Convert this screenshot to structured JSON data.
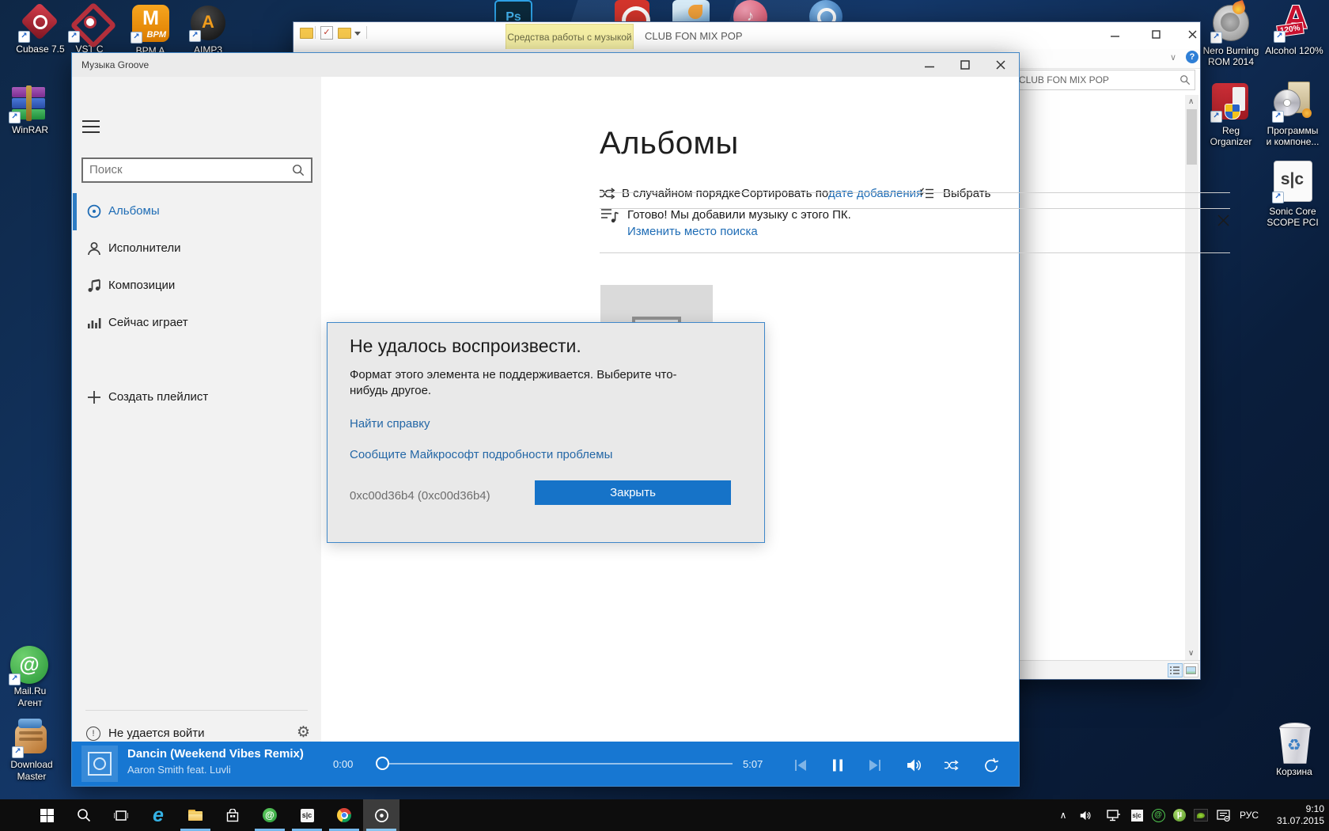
{
  "colors": {
    "accent": "#1777d2",
    "link_blue": "#1e6cb5",
    "dialog_button": "#1673c8",
    "nav_selected": "#2d7cc4",
    "taskbar_underline": "#76b9ed",
    "ribbon_tab_bg": "#f5efa5",
    "player_bar": "#1777d2"
  },
  "desktop": {
    "icons_top_left": [
      {
        "id": "cubase",
        "label": "Cubase 7.5"
      },
      {
        "id": "vst-connect",
        "label": "VST C"
      },
      {
        "id": "bpm-analyzer",
        "label": "BPM A"
      },
      {
        "id": "aimp3",
        "label": "AIMP3"
      }
    ],
    "icons_left": [
      {
        "id": "winrar",
        "label": "WinRAR"
      },
      {
        "id": "mailru-agent",
        "line1": "Mail.Ru",
        "line2": "Агент"
      },
      {
        "id": "download-master",
        "line1": "Download",
        "line2": "Master"
      }
    ],
    "icons_right": [
      {
        "id": "nero",
        "line1": "Nero Burning",
        "line2": "ROM 2014"
      },
      {
        "id": "alcohol",
        "line1": "Alcohol 120%",
        "line2": ""
      },
      {
        "id": "reg-organizer",
        "line1": "Reg",
        "line2": "Organizer"
      },
      {
        "id": "programs",
        "line1": "Программы",
        "line2": "и компоне..."
      },
      {
        "id": "sonic-core",
        "line1": "Sonic Core",
        "line2": "SCOPE PCI"
      },
      {
        "id": "recycle-bin",
        "line1": "Корзина",
        "line2": ""
      }
    ]
  },
  "explorer": {
    "ribbon_tab": "Средства работы с музыкой",
    "title": "CLUB FON MIX POP",
    "search_value": "Поиск: CLUB FON MIX POP"
  },
  "groove": {
    "window_title": "Музыка Groove",
    "sidebar": {
      "search_placeholder": "Поиск",
      "items": [
        {
          "label": "Альбомы"
        },
        {
          "label": "Исполнители"
        },
        {
          "label": "Композиции"
        },
        {
          "label": "Сейчас играет"
        }
      ],
      "create_playlist": "Создать плейлист",
      "signin_status": "Не удается войти"
    },
    "main": {
      "heading": "Альбомы",
      "shuffle_label": "В случайном порядке",
      "sort_label": "Сортировать по:",
      "sort_value": "дате добавления",
      "select_label": "Выбрать",
      "notice_text": "Готово! Мы добавили музыку с этого ПК.",
      "notice_link": "Изменить место поиска"
    },
    "dialog": {
      "title": "Не удалось воспроизвести.",
      "body": "Формат этого элемента не поддерживается. Выберите что-нибудь другое.",
      "help_link": "Найти справку",
      "report_link": "Сообщите Майкрософт подробности проблемы",
      "error_code": "0xc00d36b4 (0xc00d36b4)",
      "close_button": "Закрыть"
    },
    "player": {
      "track_title": "Dancin (Weekend Vibes Remix)",
      "track_artist": "Aaron Smith feat. Luvli",
      "time_elapsed": "0:00",
      "time_total": "5:07"
    }
  },
  "taskbar": {
    "language": "РУС",
    "time": "9:10",
    "date": "31.07.2015"
  }
}
